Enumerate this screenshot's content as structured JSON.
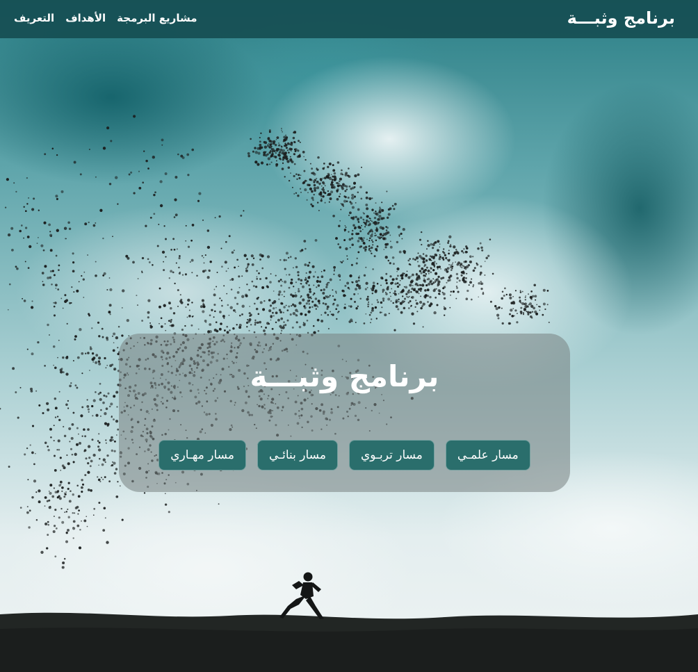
{
  "navbar": {
    "brand": "برنامج وثبـــة",
    "links": [
      "التعريف",
      "الأهداف",
      "مشاريع البرمجة"
    ]
  },
  "hero": {
    "title": "برنامج وثبـــة",
    "tracks": [
      "مسار علمـي",
      "مسار تربـوي",
      "مسار بنائـي",
      "مسار مهـاري"
    ]
  },
  "colors": {
    "navbar_bg": "#164e52",
    "button_bg": "#2a6e6c",
    "text": "#ffffff"
  }
}
